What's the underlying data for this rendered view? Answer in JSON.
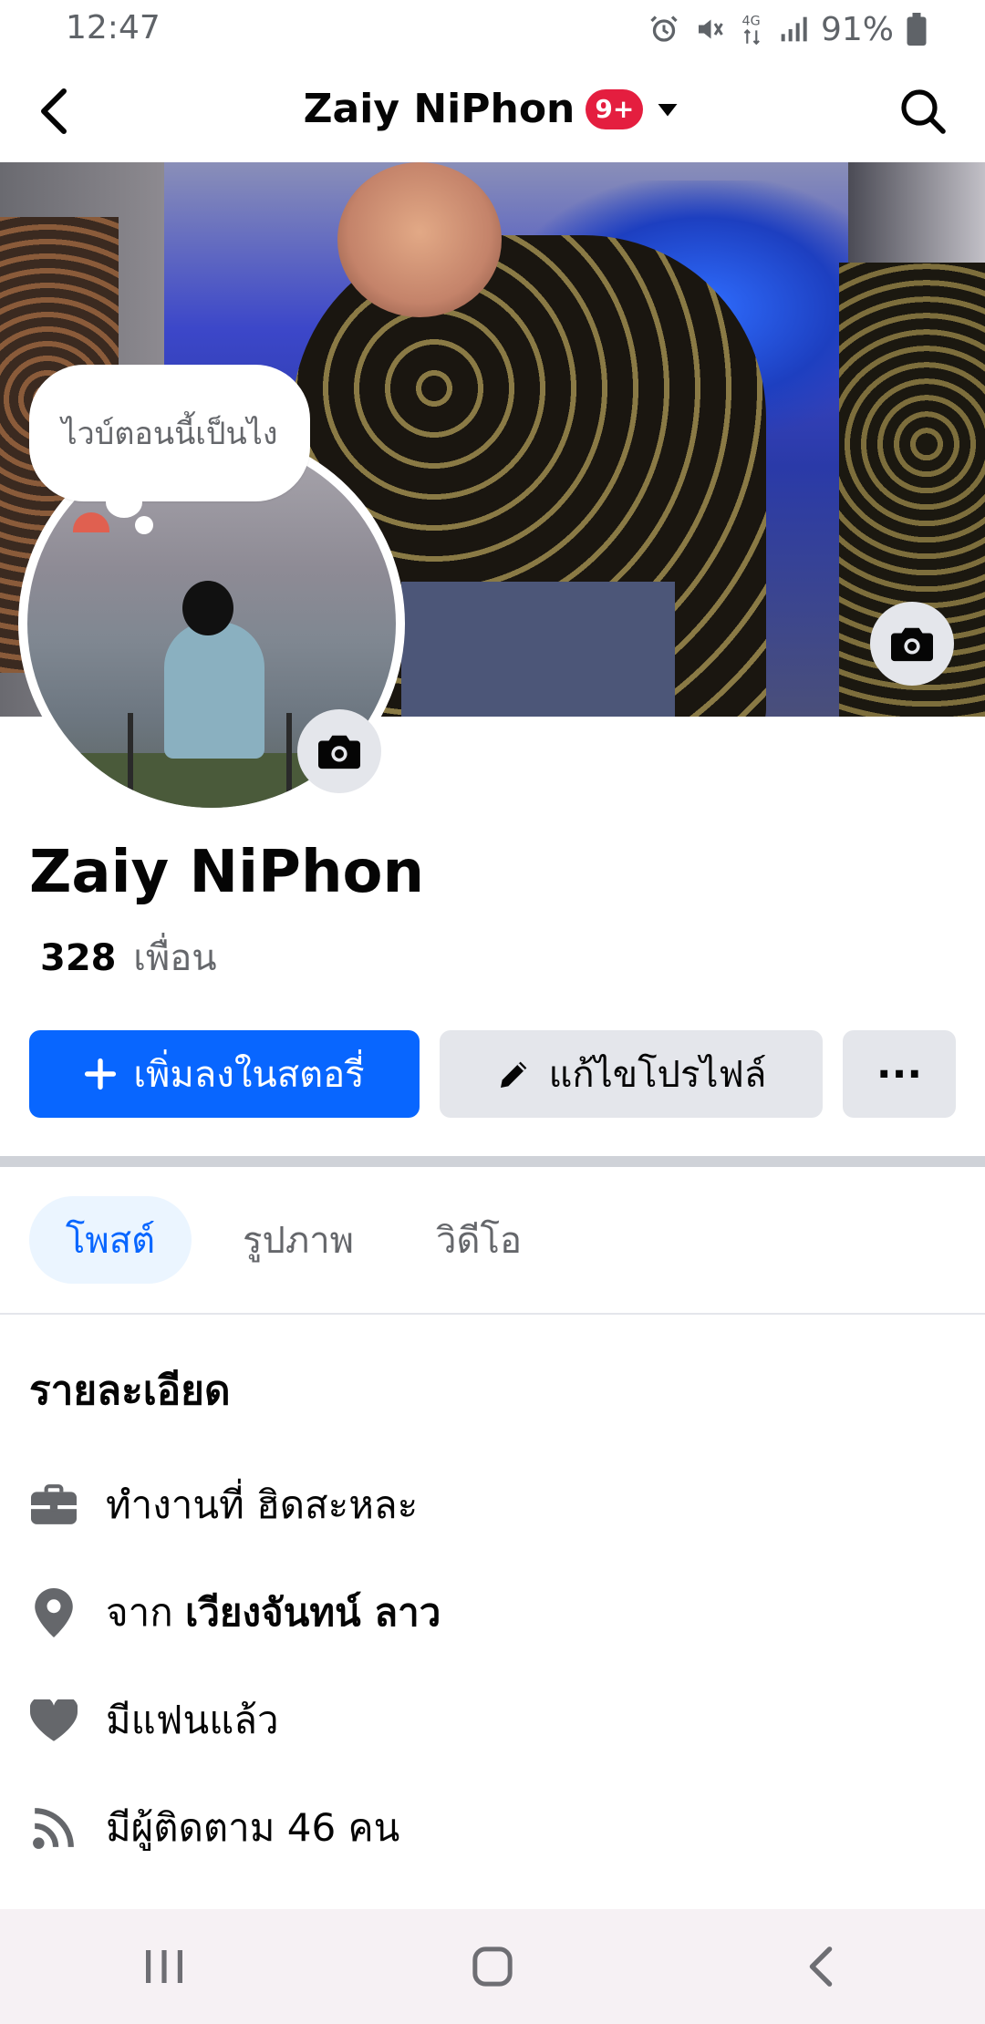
{
  "status_bar": {
    "time": "12:47",
    "battery_percent": "91%",
    "icons": [
      "alarm-icon",
      "mute-icon",
      "4g-icon",
      "signal-icon",
      "battery-icon"
    ]
  },
  "header": {
    "title": "Zaiy NiPhon",
    "notification_badge": "9+",
    "icons": [
      "back-arrow-icon",
      "caret-down-icon",
      "search-icon"
    ]
  },
  "profile": {
    "status_bubble": "ไวบ์ตอนนี้เป็นไง",
    "name": "Zaiy NiPhon",
    "friends_count": "328",
    "friends_label": "เพื่อน"
  },
  "actions": {
    "add_story": "เพิ่มลงในสตอรี่",
    "edit_profile": "แก้ไขโปรไฟล์",
    "more": "···"
  },
  "tabs": [
    {
      "label": "โพสต์",
      "active": true
    },
    {
      "label": "รูปภาพ",
      "active": false
    },
    {
      "label": "วิดีโอ",
      "active": false
    }
  ],
  "details": {
    "title": "รายละเอียด",
    "work": "ทำงานที่ ฮิดสะหละ",
    "from_prefix": "จาก",
    "from_place": "เวียงจันทน์ ลาว",
    "relationship": "มีแฟนแล้ว",
    "followers": "มีผู้ติดตาม 46 คน"
  },
  "colors": {
    "accent": "#0866ff",
    "badge": "#e41e3f",
    "secondary_text": "#65676b",
    "button_gray": "#e4e6eb"
  }
}
